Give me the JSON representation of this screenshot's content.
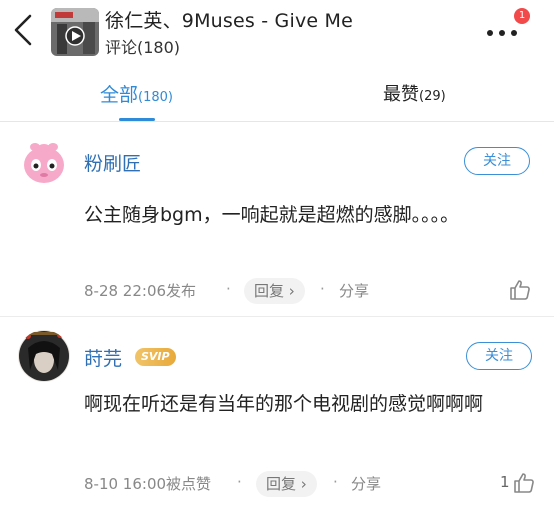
{
  "header": {
    "title": "徐仁英、9Muses - Give Me",
    "subtitle": "评论(180)",
    "notification_count": "1",
    "icons": {
      "back": "chevron-left-icon",
      "more": "more-dots-icon"
    }
  },
  "tabs": {
    "all_label": "全部",
    "all_count": "(180)",
    "top_label": "最赞",
    "top_count": "(29)"
  },
  "comments": [
    {
      "username": "粉刷匠",
      "follow_label": "关注",
      "content": "公主随身bgm，一响起就是超燃的感脚。。。。",
      "time": "8-28 22:06发布",
      "reply_label": "回复 ›",
      "share_label": "分享",
      "likes": ""
    },
    {
      "username": "莳芫",
      "vip_badge": "SVIP",
      "follow_label": "关注",
      "content": "啊现在听还是有当年的那个电视剧的感觉啊啊啊",
      "time": "8-10 16:00被点赞",
      "reply_label": "回复 ›",
      "share_label": "分享",
      "likes": "1"
    }
  ],
  "colors": {
    "accent": "#2f8bd8",
    "username": "#2f6fb3",
    "badge": "#f24a4a",
    "svip": "#e8a93b"
  }
}
